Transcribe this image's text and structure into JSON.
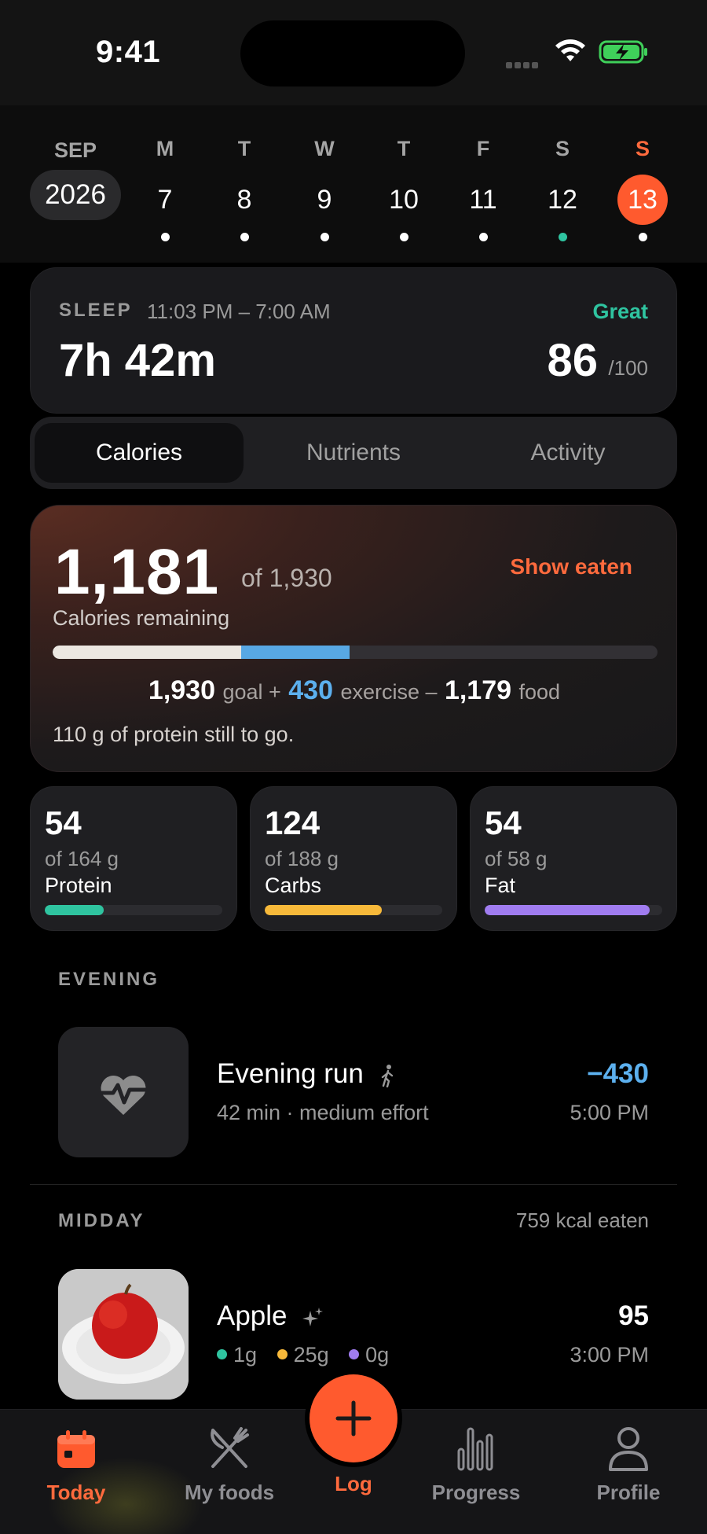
{
  "status_bar": {
    "time": "9:41"
  },
  "calendar": {
    "month": "SEP",
    "year": "2026",
    "days": [
      {
        "dow": "M",
        "num": "7",
        "dot_color": "#ffffff"
      },
      {
        "dow": "T",
        "num": "8",
        "dot_color": "#ffffff"
      },
      {
        "dow": "W",
        "num": "9",
        "dot_color": "#ffffff"
      },
      {
        "dow": "T",
        "num": "10",
        "dot_color": "#ffffff"
      },
      {
        "dow": "F",
        "num": "11",
        "dot_color": "#ffffff"
      },
      {
        "dow": "S",
        "num": "12",
        "dot_color": "#2fc4a0"
      },
      {
        "dow": "S",
        "num": "13",
        "dot_color": "#ffffff",
        "selected": true
      }
    ]
  },
  "sleep": {
    "label": "SLEEP",
    "range": "11:03 PM – 7:00 AM",
    "duration": "7h 42m",
    "rating": "Great",
    "score": "86",
    "score_max": "/100"
  },
  "tabs": [
    {
      "label": "Calories",
      "active": true
    },
    {
      "label": "Nutrients",
      "active": false
    },
    {
      "label": "Activity",
      "active": false
    }
  ],
  "calories": {
    "remaining": "1,181",
    "of_total": "of 1,930",
    "show_eaten": "Show eaten",
    "remaining_label": "Calories remaining",
    "goal": "1,930",
    "goal_label": "goal +",
    "exercise": "430",
    "exercise_label": "exercise –",
    "food": "1,179",
    "food_label": "food",
    "protein_note": "110 g of protein still to go.",
    "bar": {
      "food_fraction": 0.312,
      "exercise_fraction": 0.179
    },
    "colors": {
      "food": "#ece7e1",
      "exercise": "#58a8e4"
    }
  },
  "macros": [
    {
      "value": "54",
      "of": "of 164 g",
      "name": "Protein",
      "fraction": 0.33,
      "color": "#2fc4a0"
    },
    {
      "value": "124",
      "of": "of 188 g",
      "name": "Carbs",
      "fraction": 0.66,
      "color": "#f7b93a"
    },
    {
      "value": "54",
      "of": "of 58 g",
      "name": "Fat",
      "fraction": 0.93,
      "color": "#a07cf0"
    }
  ],
  "evening": {
    "title": "EVENING",
    "entry": {
      "name": "Evening run",
      "detail": "42 min · medium effort",
      "amount": "−430",
      "time": "5:00 PM",
      "icon": "heart-pulse-icon"
    }
  },
  "midday": {
    "title": "MIDDAY",
    "summary": "759 kcal eaten",
    "entry": {
      "name": "Apple",
      "protein": "1g",
      "carbs": "25g",
      "fat": "0g",
      "amount": "95",
      "time": "3:00 PM"
    }
  },
  "tabbar": {
    "items": [
      {
        "label": "Today",
        "icon": "calendar-icon",
        "active": true
      },
      {
        "label": "My foods",
        "icon": "fork-knife-icon",
        "active": false
      },
      {
        "label": "Log",
        "icon": "plus-icon",
        "active": true
      },
      {
        "label": "Progress",
        "icon": "bar-chart-icon",
        "active": false
      },
      {
        "label": "Profile",
        "icon": "person-icon",
        "active": false
      }
    ]
  },
  "accent_color": "#ff5a2e"
}
